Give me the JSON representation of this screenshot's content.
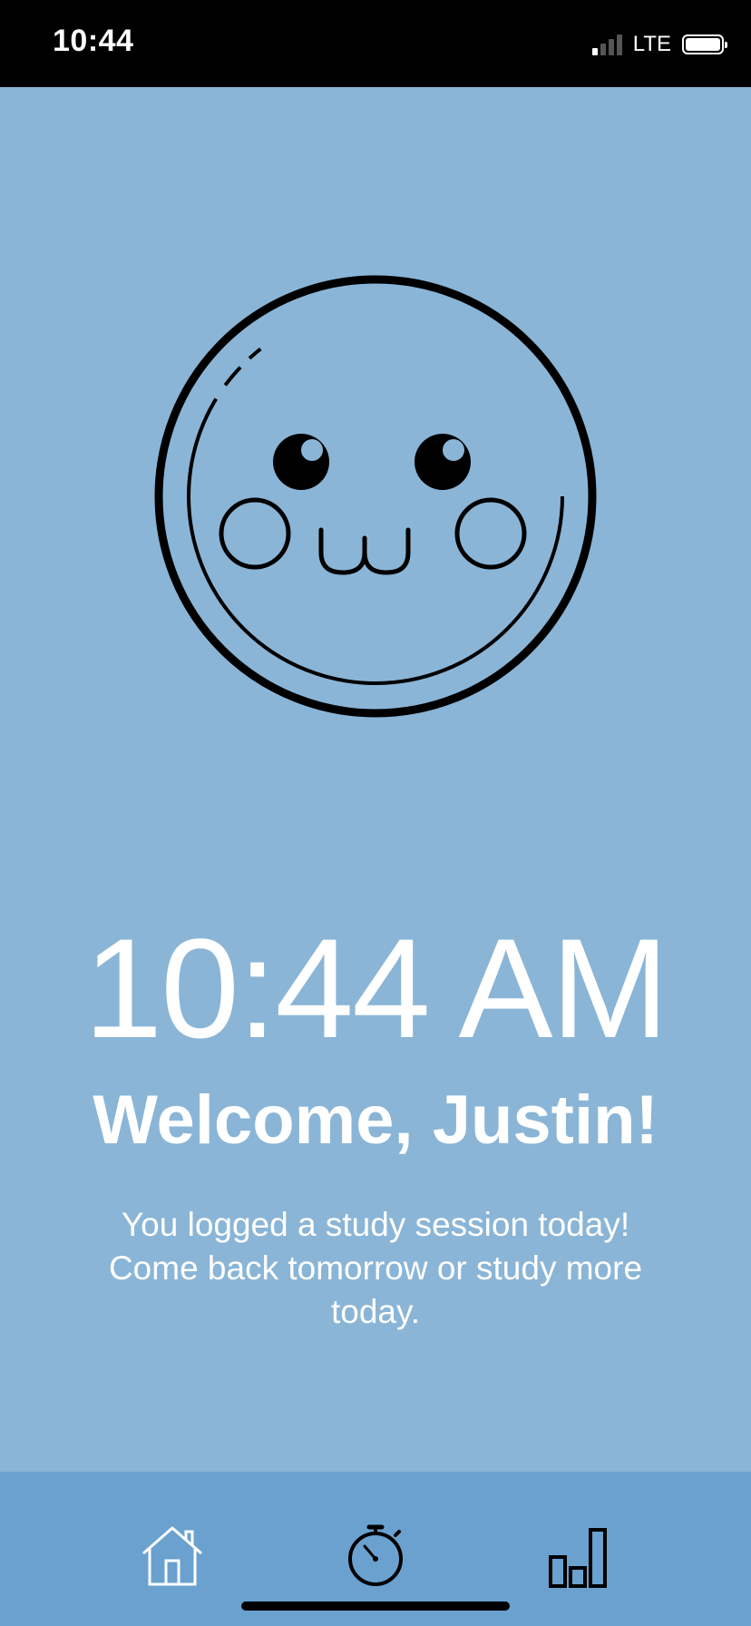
{
  "status_bar": {
    "time": "10:44",
    "network": "LTE",
    "icons": [
      "signal-icon",
      "battery-icon"
    ]
  },
  "mascot": {
    "icon": "owo-face-icon"
  },
  "main": {
    "clock": "10:44 AM",
    "welcome": "Welcome, Justin!",
    "message": "You logged a study session today! Come back tomorrow or study more today."
  },
  "bottom_nav": {
    "items": [
      {
        "icon": "home-icon"
      },
      {
        "icon": "stopwatch-icon"
      },
      {
        "icon": "bar-chart-icon"
      }
    ]
  },
  "colors": {
    "background": "#8ab5d6",
    "nav_background": "#6aa1cf",
    "status_bar": "#000000",
    "text": "#ffffff"
  }
}
